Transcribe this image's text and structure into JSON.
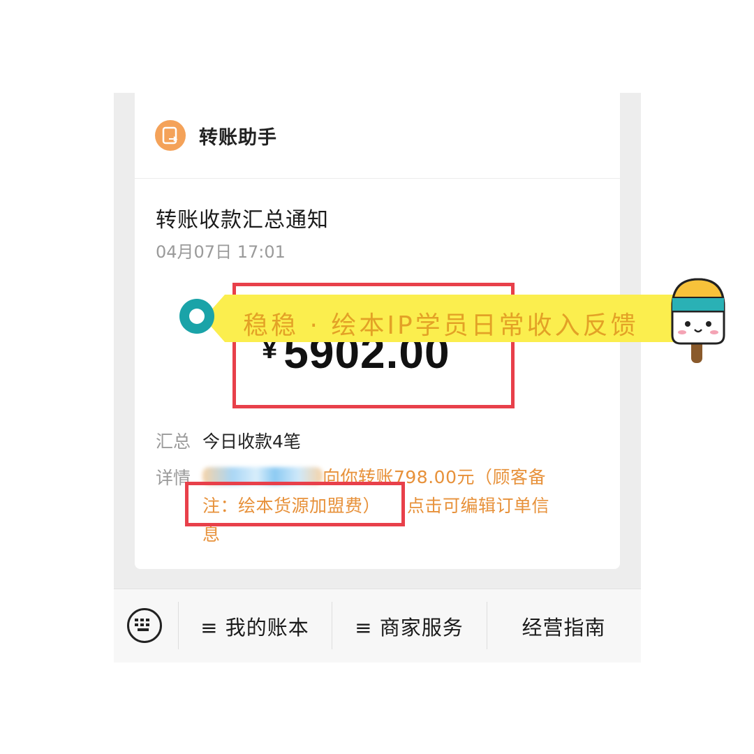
{
  "header": {
    "app_name": "转账助手"
  },
  "notification": {
    "title": "转账收款汇总通知",
    "time": "04月07日 17:01",
    "currency": "¥",
    "amount": "5902.00",
    "summary_label": "汇总",
    "summary_value": "今日收款4笔",
    "detail_label": "详情",
    "detail_text_1": "向你转账798.00元（顾客备",
    "detail_text_2": "注：绘本货源加盟费）",
    "detail_text_3": "点击可编辑订单信",
    "detail_text_4": "息"
  },
  "banner": {
    "text": "稳稳 · 绘本IP学员日常收入反馈"
  },
  "bottom_bar": {
    "tabs": [
      {
        "label": "≡ 我的账本"
      },
      {
        "label": "≡ 商家服务"
      },
      {
        "label": "经营指南"
      }
    ]
  },
  "colors": {
    "accent_orange": "#e7913a",
    "highlight_red": "#e8404a",
    "banner_yellow": "#fbee4e",
    "teal": "#1aa3a8"
  }
}
